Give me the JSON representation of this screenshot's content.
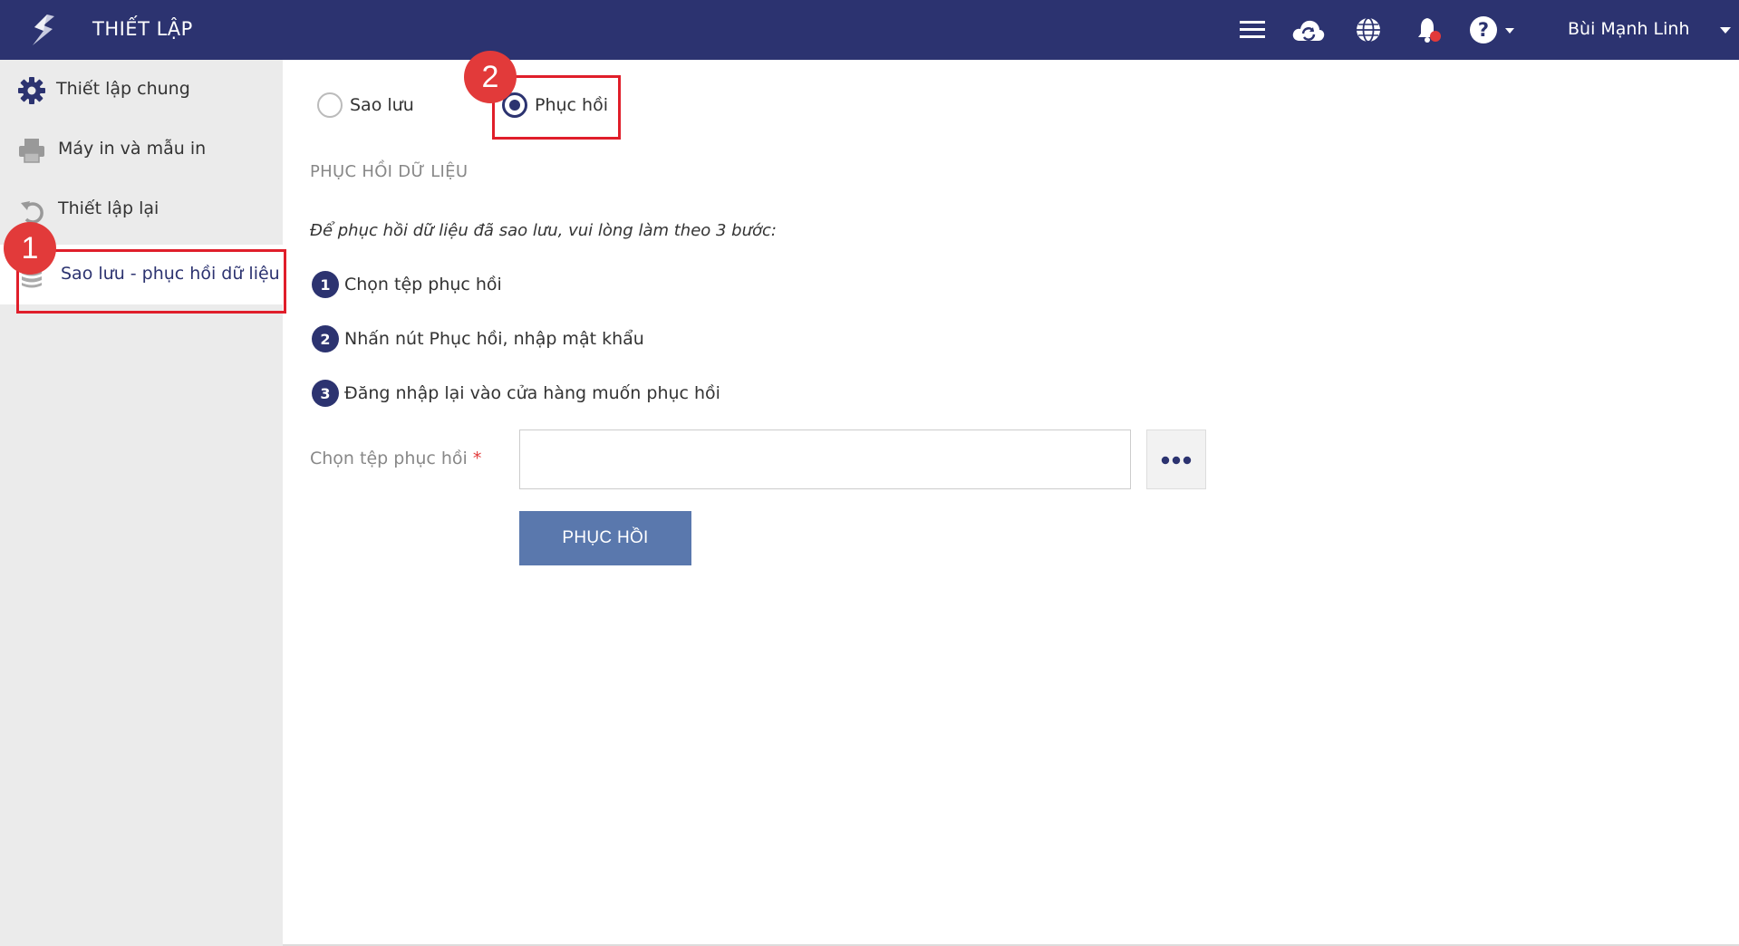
{
  "header": {
    "title": "THIẾT LẬP",
    "user_name": "Bùi Mạnh Linh",
    "icons": [
      "logo-icon",
      "menu-icon",
      "cloud-sync-icon",
      "globe-icon",
      "bell-icon",
      "help-icon"
    ]
  },
  "sidebar": {
    "items": [
      {
        "label": "Thiết lập chung",
        "icon": "gear-icon"
      },
      {
        "label": "Máy in và mẫu in",
        "icon": "printer-icon"
      },
      {
        "label": "Thiết lập lại",
        "icon": "undo-icon"
      },
      {
        "label": "Sao lưu - phục hồi dữ liệu",
        "icon": "database-icon",
        "active": true
      }
    ]
  },
  "main": {
    "options": [
      {
        "label": "Sao lưu",
        "checked": false
      },
      {
        "label": "Phục hồi",
        "checked": true
      }
    ],
    "section_title": "PHỤC HỒI DỮ LIỆU",
    "intro": "Để phục hồi dữ liệu đã sao lưu, vui lòng làm theo 3 bước:",
    "steps": [
      {
        "num": "1",
        "text": "Chọn tệp phục hồi"
      },
      {
        "num": "2",
        "text": "Nhấn nút Phục hồi, nhập mật khẩu"
      },
      {
        "num": "3",
        "text": "Đăng nhập lại vào cửa hàng muốn phục hồi"
      }
    ],
    "file_label": "Chọn tệp phục hồi",
    "required_mark": "*",
    "file_value": "",
    "restore_button": "PHỤC HỒI"
  },
  "annotations": {
    "callout_1": "1",
    "callout_2": "2"
  },
  "colors": {
    "header_bg": "#2c3370",
    "accent": "#2c3370",
    "button": "#5a78ad",
    "highlight": "#e01e2a",
    "callout": "#e23a3a"
  }
}
